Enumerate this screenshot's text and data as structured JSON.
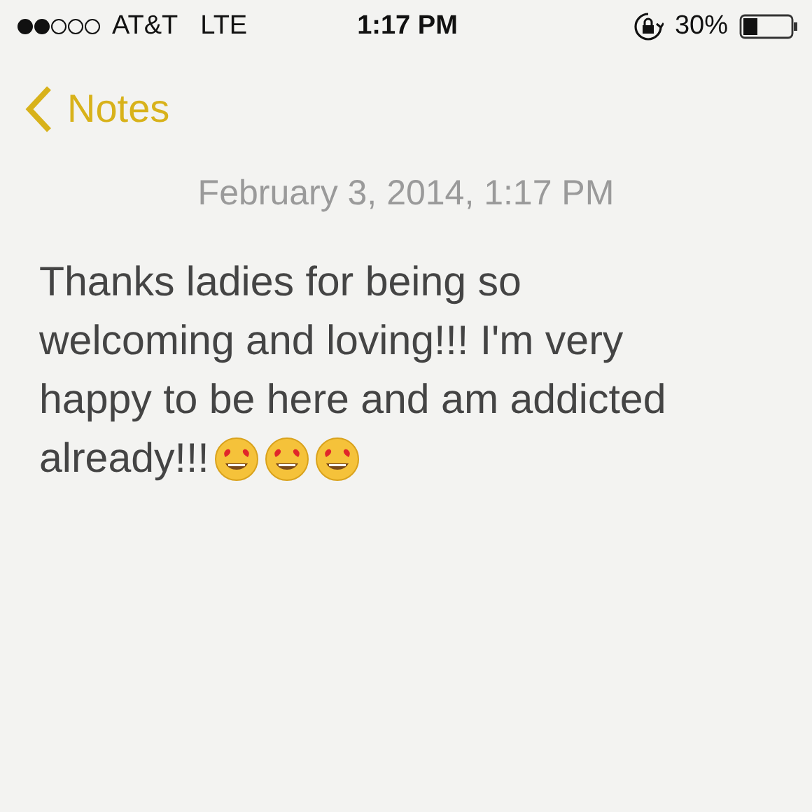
{
  "status_bar": {
    "carrier": "AT&T",
    "network": "LTE",
    "time": "1:17 PM",
    "battery": "30%"
  },
  "nav": {
    "back_label": "Notes"
  },
  "note": {
    "date": "February 3, 2014, 1:17 PM",
    "lines": [
      "Thanks ladies for being so",
      "welcoming and loving!!! I'm very",
      "happy to be here and am addicted",
      "already!!!"
    ],
    "emoji": [
      {
        "kind": "heart-eyes"
      },
      {
        "kind": "heart-eyes"
      },
      {
        "kind": "heart-eyes"
      }
    ]
  }
}
